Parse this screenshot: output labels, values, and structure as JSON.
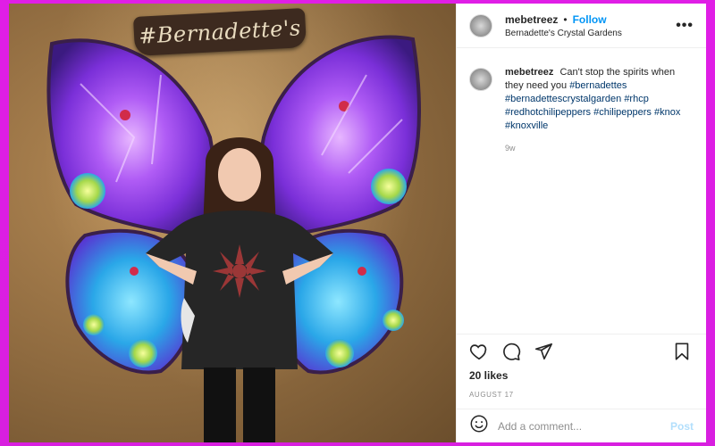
{
  "post": {
    "image_alt": "Girl posing in front of illuminated purple crystal butterfly wings",
    "sign_text": "#Bernadette's"
  },
  "header": {
    "username": "mebetreez",
    "separator": "•",
    "follow_label": "Follow",
    "location": "Bernadette's Crystal Gardens",
    "more_icon": "more-horizontal-icon"
  },
  "caption": {
    "username": "mebetreez",
    "text": "Can't stop the spirits when they need you",
    "tags": [
      "#bernadettes",
      "#bernadettescrystalgarden",
      "#rhcp",
      "#redhotchilipeppers",
      "#chilipeppers",
      "#knox",
      "#knoxville"
    ],
    "age": "9w"
  },
  "actions": {
    "like_icon": "heart-icon",
    "comment_icon": "comment-icon",
    "share_icon": "share-icon",
    "save_icon": "bookmark-icon"
  },
  "likes": "20 likes",
  "date": "AUGUST 17",
  "add_comment": {
    "placeholder": "Add a comment...",
    "post_label": "Post",
    "emoji_icon": "emoji-icon"
  },
  "colors": {
    "background": "#dd1fe3",
    "link": "#0095f6",
    "hashtag": "#00376b",
    "wing_purple": "#9b3df0",
    "wing_blue": "#2aa7e8"
  }
}
